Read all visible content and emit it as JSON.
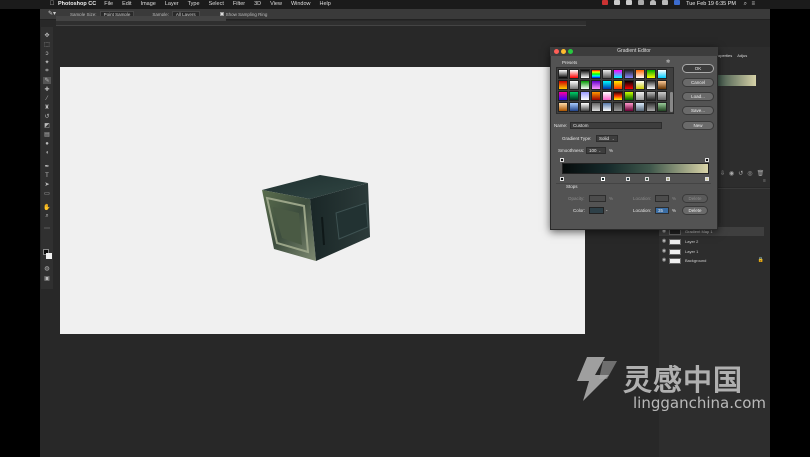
{
  "menubar": {
    "app_name": "Photoshop CC",
    "menus": [
      "File",
      "Edit",
      "Image",
      "Layer",
      "Type",
      "Select",
      "Filter",
      "3D",
      "View",
      "Window",
      "Help"
    ],
    "clock": "Tue Feb 19  6:35 PM"
  },
  "options_bar": {
    "sample_size_label": "Sample Size:",
    "sample_size_value": "Point Sample",
    "sample_label": "Sample:",
    "sample_value": "All Layers",
    "show_ring_label": "Show Sampling Ring"
  },
  "properties_panel": {
    "tabs": [
      "Properties",
      "Adjus"
    ]
  },
  "layers": [
    {
      "name": "Gradient Map 1",
      "visible": true,
      "selected": true
    },
    {
      "name": "Layer 2",
      "visible": true
    },
    {
      "name": "Layer 1",
      "visible": true
    },
    {
      "name": "Background",
      "visible": true,
      "locked": true
    }
  ],
  "dialog": {
    "title": "Gradient Editor",
    "presets_label": "Presets",
    "buttons": {
      "ok": "OK",
      "cancel": "Cancel",
      "load": "Load...",
      "save": "Save...",
      "new": "New"
    },
    "name_label": "Name:",
    "name_value": "Custom",
    "gradient_type_label": "Gradient Type:",
    "gradient_type_value": "Solid",
    "smoothness_label": "Smoothness:",
    "smoothness_value": "100",
    "smoothness_unit": "%",
    "stops_label": "Stops",
    "opacity_label": "Opacity:",
    "opacity_unit": "%",
    "location_label": "Location:",
    "delete_label": "Delete",
    "color_label": "Color:",
    "location2_label": "Location:",
    "location2_value": "35",
    "location2_unit": "%",
    "delete2_label": "Delete",
    "gradient_colors": [
      "#070c0c",
      "#15292a",
      "#3f574b",
      "#d9d4a8"
    ]
  },
  "watermark": {
    "cn": "灵感中国",
    "url": "lingganchina.com"
  },
  "preset_gradients": [
    "linear-gradient(180deg,#ffffff,#000000)",
    "linear-gradient(180deg,#ffffff,#ff0000)",
    "linear-gradient(180deg,#000000,#ffffff)",
    "linear-gradient(180deg,#ff0000,#ffff00,#00ff00,#00ffff,#0000ff)",
    "linear-gradient(180deg,#eeeeee,#555555)",
    "linear-gradient(180deg,#ff00ff,#00ffff)",
    "linear-gradient(180deg,#222222,#8888ff)",
    "linear-gradient(180deg,#ff6600,#ffffff)",
    "linear-gradient(180deg,#00aa00,#ffff00)",
    "linear-gradient(180deg,#ffffff,#00ccff)",
    "linear-gradient(180deg,#cc0000,#ffcc00)",
    "linear-gradient(180deg,#ffffff,#777777)",
    "linear-gradient(180deg,#009900,#ffffff)",
    "linear-gradient(180deg,#6600cc,#ff99ff)",
    "linear-gradient(180deg,#00ffff,#0033aa)",
    "linear-gradient(180deg,#ffee00,#ff3300)",
    "linear-gradient(180deg,#000000,#ff0000)",
    "linear-gradient(180deg,#ffffff,#cccc00)",
    "linear-gradient(180deg,#333333,#ffffff)",
    "linear-gradient(180deg,#ffcc99,#663300)",
    "linear-gradient(180deg,#ff0099,#3300ff)",
    "linear-gradient(180deg,#00cc66,#003322)",
    "linear-gradient(180deg,#9999ff,#ffffff)",
    "linear-gradient(180deg,#ff9900,#990000)",
    "linear-gradient(180deg,#ffffff,#ff66cc)",
    "linear-gradient(180deg,#330000,#ff3300,#ffff00)",
    "linear-gradient(180deg,#ccff00,#006600)",
    "linear-gradient(180deg,#eeeeee,#999999)",
    "linear-gradient(180deg,#bbbbbb,#222222)",
    "linear-gradient(180deg,#cccccc,#666666)",
    "linear-gradient(180deg,#ffddaa,#aa5500)",
    "linear-gradient(180deg,#aaccff,#224488)",
    "linear-gradient(180deg,#ffffff,#444444)",
    "linear-gradient(180deg,#666666,#dddddd)",
    "linear-gradient(180deg,#5577aa,#ffffff)",
    "linear-gradient(180deg,#444444,#999999)",
    "linear-gradient(180deg,#ff99cc,#660033)",
    "linear-gradient(180deg,#ddeeff,#556677)",
    "linear-gradient(180deg,#333333,#aaaaaa)",
    "linear-gradient(180deg,#99cc99,#224422)"
  ]
}
